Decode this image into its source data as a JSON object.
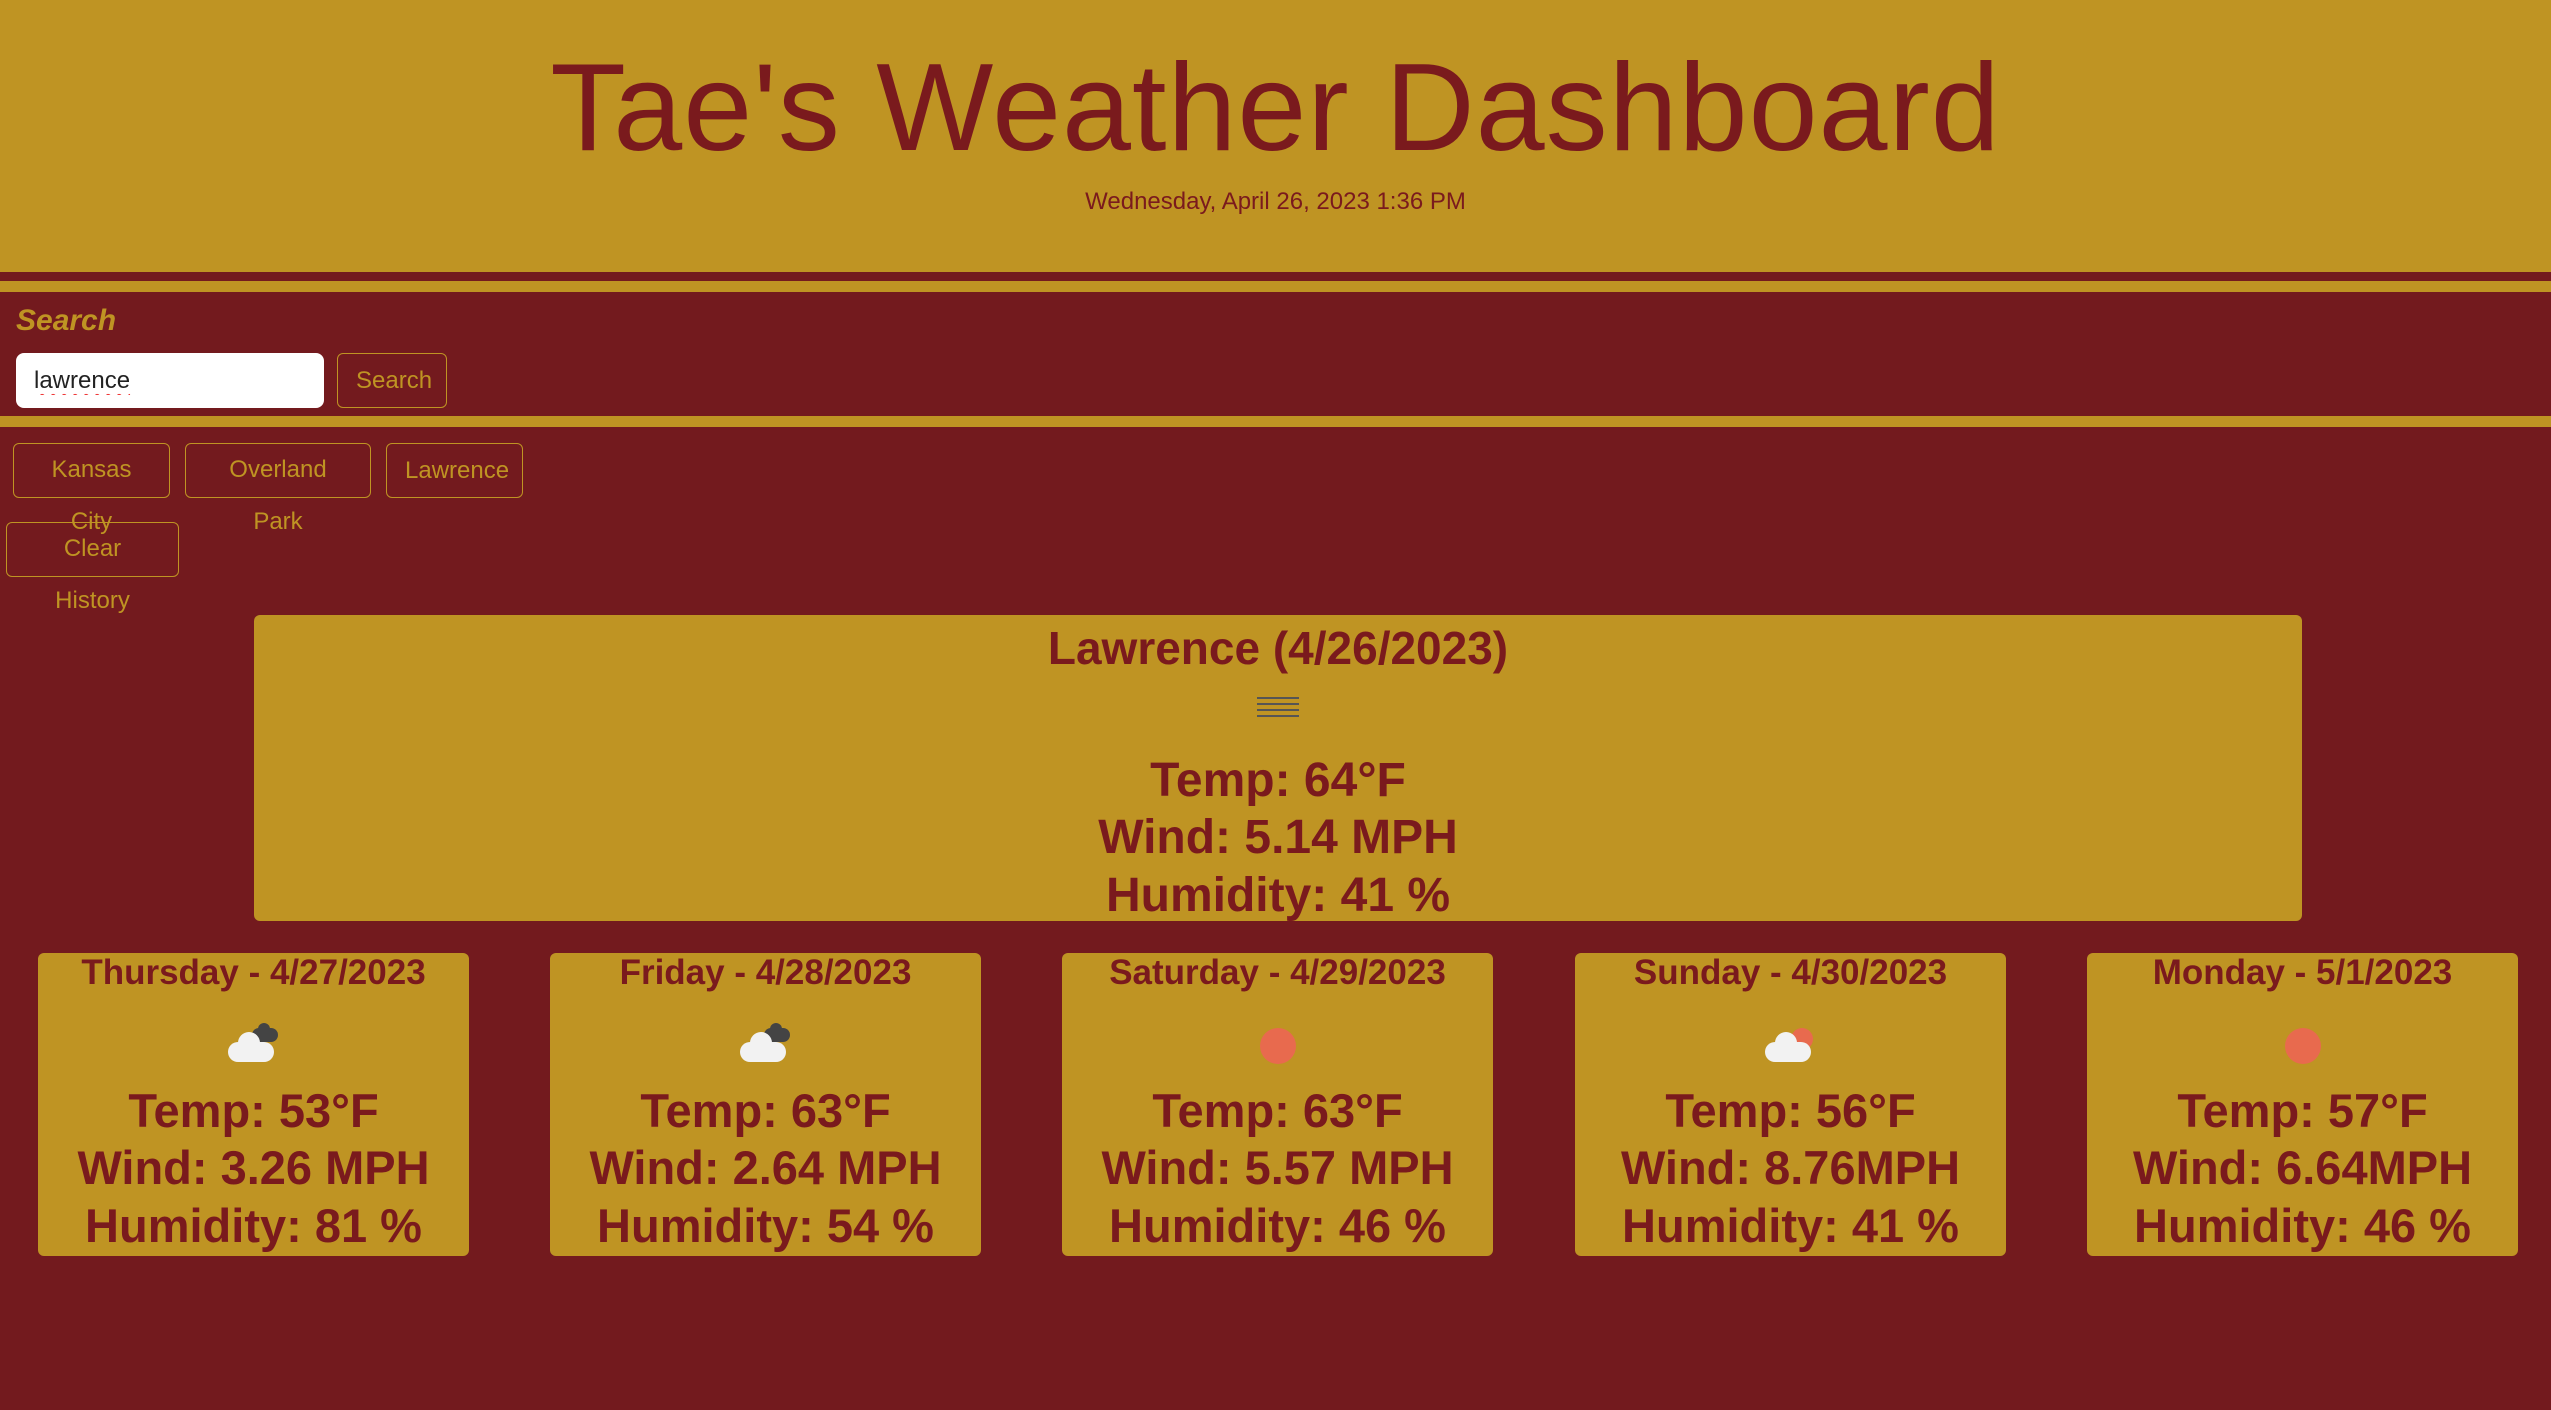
{
  "header": {
    "title": "Tae's Weather Dashboard",
    "datetime": "Wednesday, April 26, 2023 1:36 PM"
  },
  "search": {
    "label": "Search",
    "input_value": "lawrence",
    "button_label": "Search"
  },
  "history": {
    "items": [
      "Kansas City",
      "Overland Park",
      "Lawrence"
    ],
    "clear_label": "Clear History"
  },
  "current": {
    "city": "Lawrence (4/26/2023)",
    "icon": "mist-icon",
    "temp": "Temp: 64°F",
    "wind": "Wind: 5.14 MPH",
    "humidity": "Humidity: 41 %"
  },
  "forecast": [
    {
      "date": "Thursday - 4/27/2023",
      "icon": "broken-clouds-icon",
      "temp": "Temp: 53°F",
      "wind": "Wind: 3.26 MPH",
      "humidity": "Humidity: 81 %"
    },
    {
      "date": "Friday - 4/28/2023",
      "icon": "broken-clouds-icon",
      "temp": "Temp: 63°F",
      "wind": "Wind: 2.64 MPH",
      "humidity": "Humidity: 54 %"
    },
    {
      "date": "Saturday - 4/29/2023",
      "icon": "sun-icon",
      "temp": "Temp: 63°F",
      "wind": "Wind: 5.57 MPH",
      "humidity": "Humidity: 46 %"
    },
    {
      "date": "Sunday - 4/30/2023",
      "icon": "partly-cloudy-icon",
      "temp": "Temp: 56°F",
      "wind": "Wind: 8.76MPH",
      "humidity": "Humidity: 41 %"
    },
    {
      "date": "Monday - 5/1/2023",
      "icon": "sun-icon",
      "temp": "Temp: 57°F",
      "wind": "Wind: 6.64MPH",
      "humidity": "Humidity: 46 %"
    }
  ],
  "colors": {
    "background": "#731a1e",
    "accent": "#bf9423",
    "text_dark": "#7a1a1d"
  }
}
